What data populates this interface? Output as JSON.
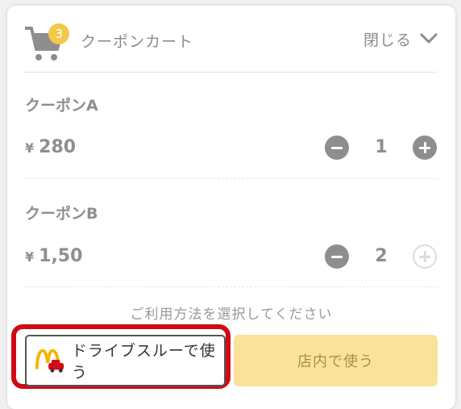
{
  "cart": {
    "title": "クーポンカート",
    "badge_count": "3",
    "close_label": "閉じる"
  },
  "items": [
    {
      "name": "クーポンA",
      "currency": "¥",
      "price": "280",
      "quantity": "1"
    },
    {
      "name": "クーポンB",
      "currency": "¥",
      "price": "1,50",
      "quantity": "2"
    }
  ],
  "hint": "ご利用方法を選択してください",
  "actions": {
    "drive_thru_label": "ドライブスルーで使う",
    "in_store_label": "店内で使う"
  },
  "colors": {
    "accent_yellow": "#fbe29a",
    "badge": "#f4c84a",
    "highlight_red": "#d10b13",
    "icon_gray": "#8e8e8e"
  }
}
